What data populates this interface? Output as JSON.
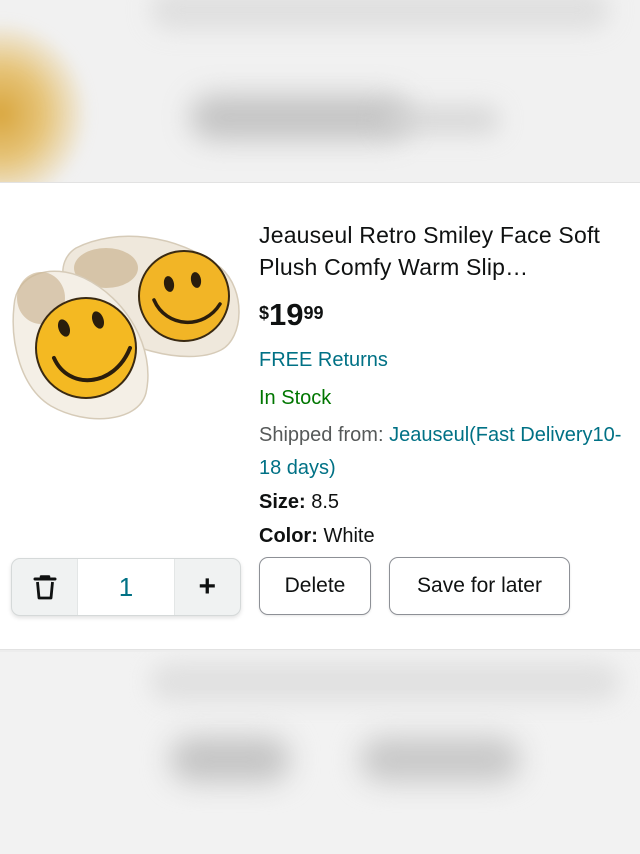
{
  "product": {
    "title": "Jeauseul Retro Smiley Face Soft Plush Comfy Warm Slip…",
    "price": {
      "symbol": "$",
      "whole": "19",
      "fraction": "99"
    },
    "returns": "FREE Returns",
    "stock_status": "In Stock",
    "shipped_label": "Shipped from:",
    "shipped_value": "Jeauseul(Fast Delivery10-18 days)",
    "size_label": "Size:",
    "size_value": "8.5",
    "color_label": "Color:",
    "color_value": "White"
  },
  "quantity": {
    "value": "1",
    "decrease_icon": "trash-icon",
    "increase_label": "+"
  },
  "actions": {
    "delete_label": "Delete",
    "save_label": "Save for later"
  },
  "colors": {
    "link": "#007185",
    "in_stock": "#007600",
    "text": "#0f1111",
    "muted": "#565959"
  }
}
